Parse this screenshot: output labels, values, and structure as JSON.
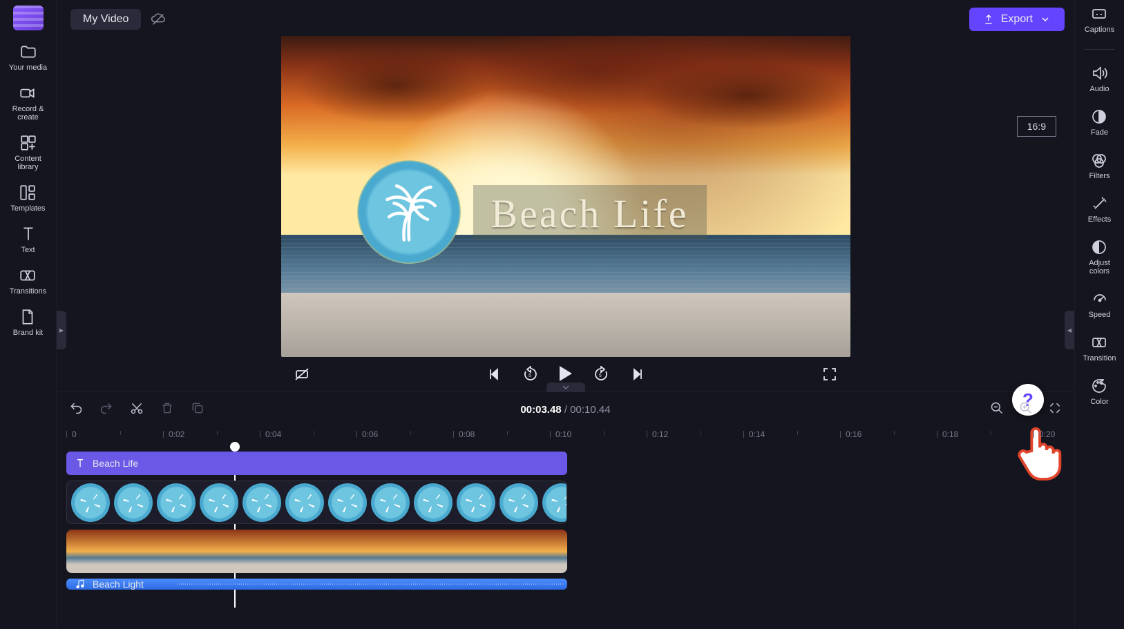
{
  "project_title": "My Video",
  "export_label": "Export",
  "aspect_ratio": "16:9",
  "preview_logo_text": "Beach Life",
  "left_nav": [
    {
      "id": "your-media",
      "label": "Your media"
    },
    {
      "id": "record-create",
      "label": "Record &\ncreate"
    },
    {
      "id": "content-library",
      "label": "Content\nlibrary"
    },
    {
      "id": "templates",
      "label": "Templates"
    },
    {
      "id": "text",
      "label": "Text"
    },
    {
      "id": "transitions",
      "label": "Transitions"
    },
    {
      "id": "brand-kit",
      "label": "Brand kit"
    }
  ],
  "right_nav": [
    {
      "id": "captions",
      "label": "Captions"
    },
    {
      "id": "audio",
      "label": "Audio"
    },
    {
      "id": "fade",
      "label": "Fade"
    },
    {
      "id": "filters",
      "label": "Filters"
    },
    {
      "id": "effects",
      "label": "Effects"
    },
    {
      "id": "adjust-colors",
      "label": "Adjust\ncolors"
    },
    {
      "id": "speed",
      "label": "Speed"
    },
    {
      "id": "transition",
      "label": "Transition"
    },
    {
      "id": "color",
      "label": "Color"
    }
  ],
  "time_current": "00:03.48",
  "time_total": "00:10.44",
  "ruler_marks": [
    "0",
    "0:02",
    "0:04",
    "0:06",
    "0:08",
    "0:10",
    "0:12",
    "0:14",
    "0:16",
    "0:18",
    "0:20"
  ],
  "tracks": {
    "text_clip_label": "Beach Life",
    "audio_clip_label": "Beach Light"
  },
  "help_tooltip": "?"
}
